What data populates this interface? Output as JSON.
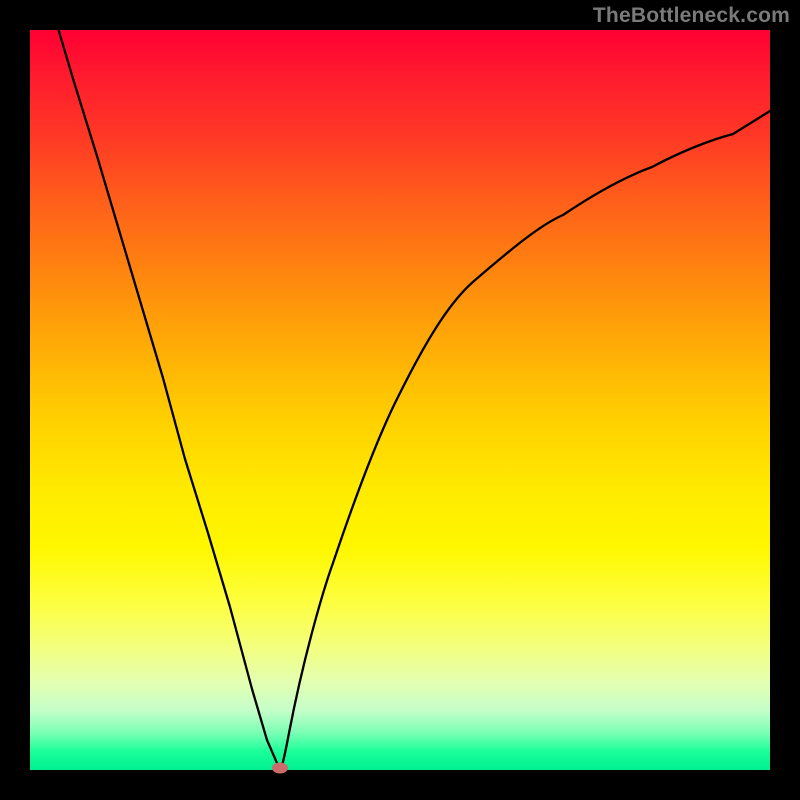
{
  "watermark": "TheBottleneck.com",
  "colors": {
    "frame": "#000000",
    "gradient_top": "#ff0033",
    "gradient_bottom": "#00f090",
    "curve": "#000000",
    "marker": "#cc6b6b"
  },
  "chart_data": {
    "type": "line",
    "title": "",
    "xlabel": "",
    "ylabel": "",
    "xlim": [
      0,
      100
    ],
    "ylim": [
      0,
      100
    ],
    "x": [
      0,
      3,
      6,
      9,
      12,
      15,
      18,
      21,
      24,
      27,
      30,
      32,
      33.8,
      35,
      38,
      41,
      45,
      50,
      55,
      60,
      66,
      72,
      78,
      84,
      90,
      95,
      100
    ],
    "values": [
      113,
      103,
      93,
      83,
      73,
      63,
      53,
      42,
      32,
      22,
      11,
      4,
      0,
      5,
      17,
      28,
      40,
      51,
      59,
      66,
      72,
      77,
      81,
      84,
      86.5,
      88,
      89
    ],
    "series": [
      {
        "name": "bottleneck-curve",
        "x": [
          0,
          3,
          6,
          9,
          12,
          15,
          18,
          21,
          24,
          27,
          30,
          32,
          33.8,
          35,
          38,
          41,
          45,
          50,
          55,
          60,
          66,
          72,
          78,
          84,
          90,
          95,
          100
        ],
        "values": [
          113,
          103,
          93,
          83,
          73,
          63,
          53,
          42,
          32,
          22,
          11,
          4,
          0,
          5,
          17,
          28,
          40,
          51,
          59,
          66,
          72,
          77,
          81,
          84,
          86.5,
          88,
          89
        ]
      }
    ],
    "marker": {
      "x": 33.8,
      "y": 0
    }
  }
}
